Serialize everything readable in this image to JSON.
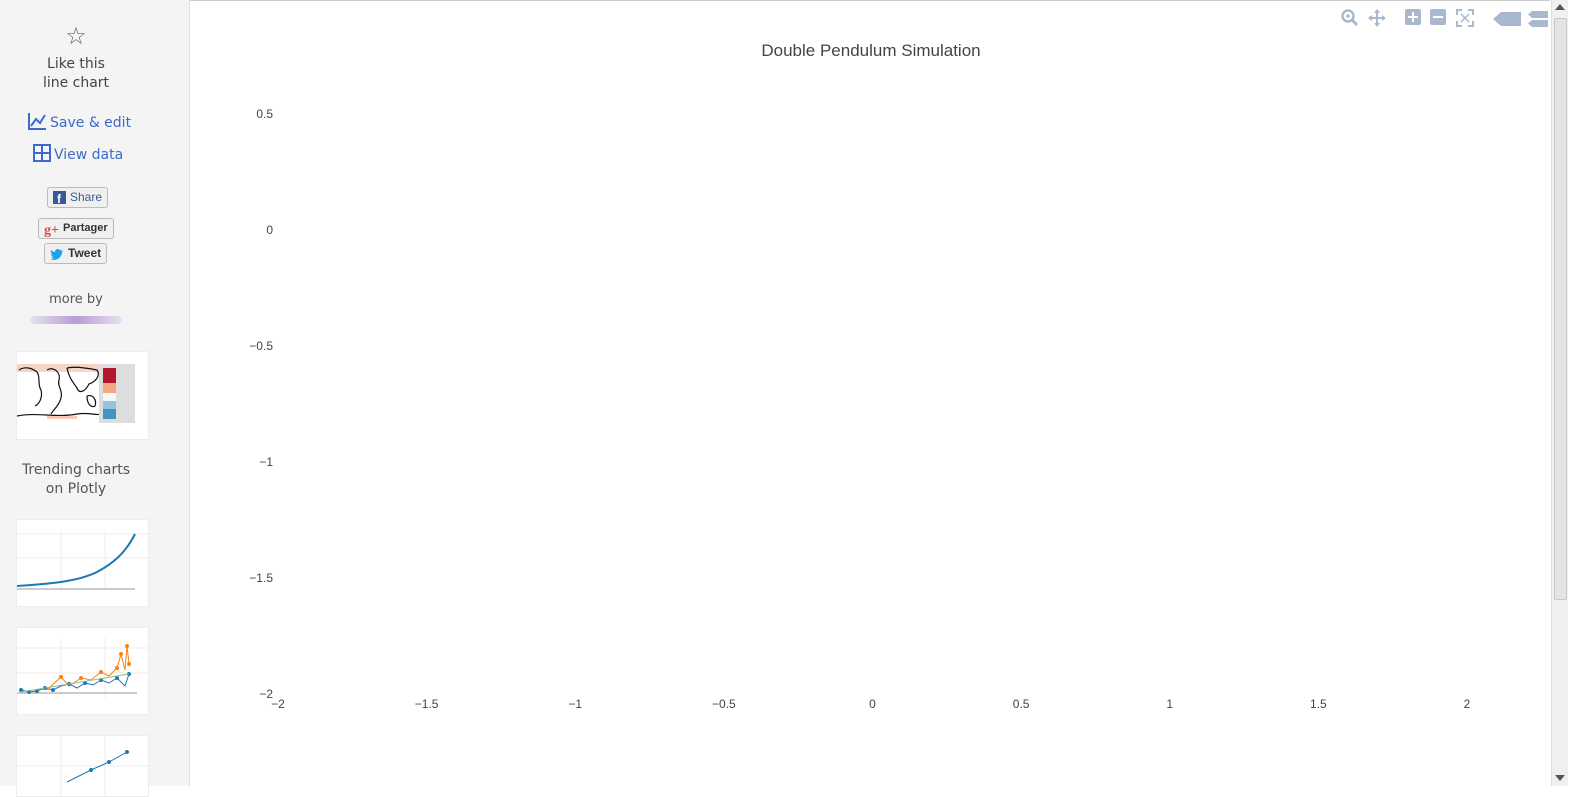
{
  "sidebar": {
    "like_line1": "Like this",
    "like_line2": "line chart",
    "save_edit": "Save & edit",
    "view_data": "View data",
    "share_fb": "Share",
    "share_gplus": "Partager",
    "share_tweet": "Tweet",
    "more_by": "more by",
    "trending_line1": "Trending charts",
    "trending_line2": "on Plotly"
  },
  "toolbar": {
    "icons": [
      "zoom-icon",
      "pan-icon",
      "zoom-in-icon",
      "zoom-out-icon",
      "autoscale-icon",
      "hover-closest-icon",
      "hover-compare-icon"
    ]
  },
  "colors": {
    "link": "#3c6bc9",
    "toolbar_icon": "#a9b8cf",
    "trend_blue": "#1f77b4",
    "trend_orange": "#ff7f0e"
  },
  "chart_data": {
    "type": "line",
    "title": "Double Pendulum Simulation",
    "xlabel": "",
    "ylabel": "",
    "xlim": [
      -2,
      2
    ],
    "ylim": [
      -2,
      0.5
    ],
    "xticks": [
      -2,
      -1.5,
      -1,
      -0.5,
      0,
      0.5,
      1,
      1.5,
      2
    ],
    "xtick_labels": [
      "−2",
      "−1.5",
      "−1",
      "−0.5",
      "0",
      "0.5",
      "1",
      "1.5",
      "2"
    ],
    "yticks": [
      0.5,
      0,
      -0.5,
      -1,
      -1.5,
      -2
    ],
    "ytick_labels": [
      "0.5",
      "0",
      "−0.5",
      "−1",
      "−1.5",
      "−2"
    ],
    "series": [],
    "grid": false
  }
}
